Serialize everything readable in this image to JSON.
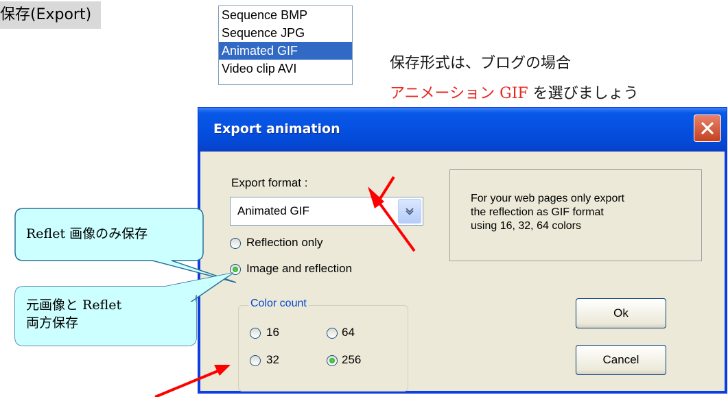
{
  "heading": "保存(Export)",
  "format_list": {
    "items": [
      "Sequence BMP",
      "Sequence JPG",
      "Animated GIF",
      "Video clip AVI"
    ],
    "selected_index": 2
  },
  "notes": {
    "line1": "保存形式は、ブログの場合",
    "line2_highlight": "アニメーション GIF",
    "line2_rest": "を選びましょう"
  },
  "callouts": {
    "reflet_only": "Reflet 画像のみ保存",
    "both_line1": "元画像と Reflet",
    "both_line2": "両方保存"
  },
  "dialog": {
    "title": "Export animation",
    "export_format_label": "Export format :",
    "export_format_value": "Animated GIF",
    "radio_reflection_only": "Reflection only",
    "radio_image_and_reflection": "Image and reflection",
    "selected_mode": "Image and reflection",
    "color_group_label": "Color count",
    "color_options": [
      "16",
      "64",
      "32",
      "256"
    ],
    "selected_color": "256",
    "info_lines": [
      "For your web pages only export",
      "the reflection as GIF format",
      "using 16, 32, 64 colors"
    ],
    "ok_label": "Ok",
    "cancel_label": "Cancel"
  },
  "colors": {
    "titlebar": "#0550e0",
    "selection": "#316ac5",
    "callout_fill": "#ccffff",
    "arrow": "#ff0000",
    "highlight_text": "#e8261f"
  }
}
